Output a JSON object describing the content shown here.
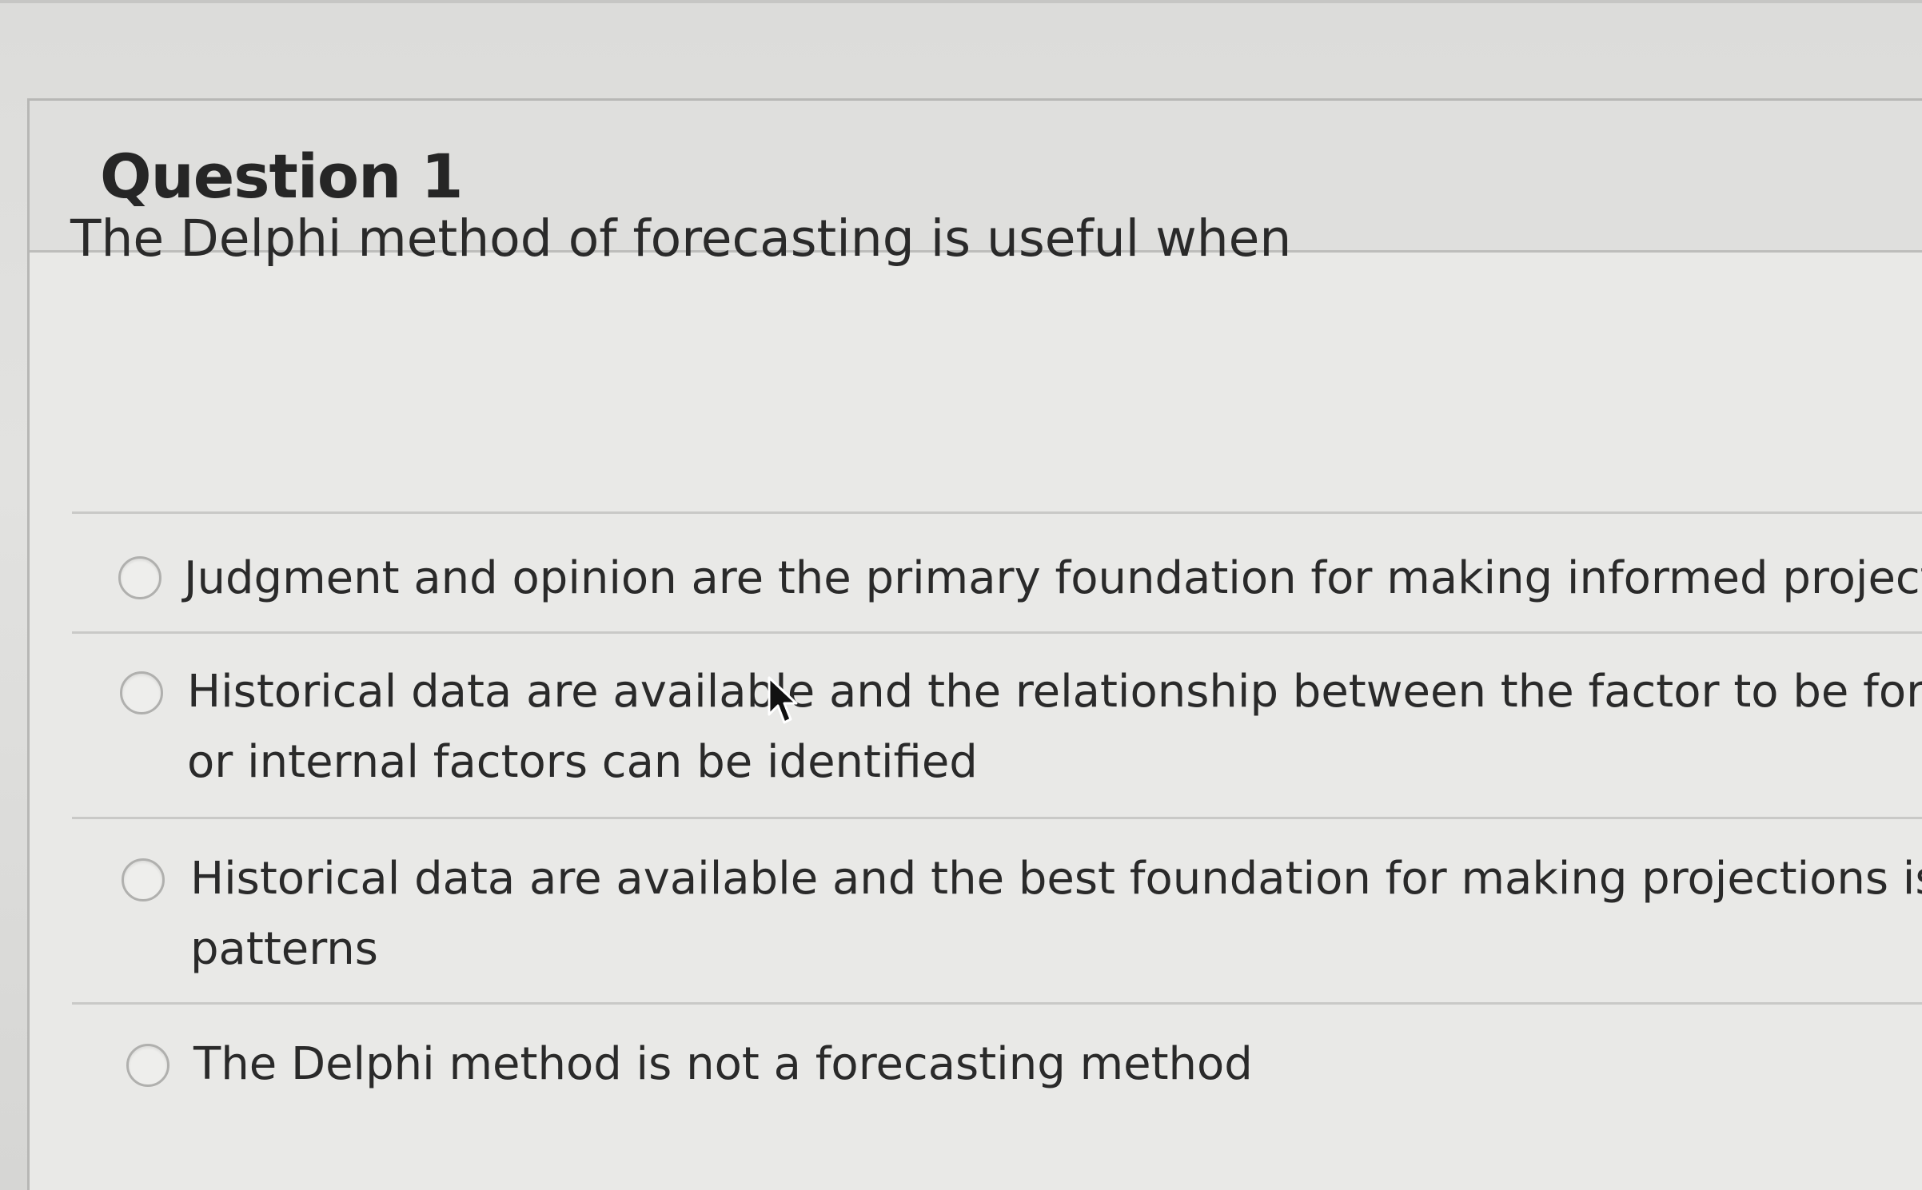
{
  "question": {
    "title": "Question 1",
    "prompt": "The Delphi method of forecasting is useful when"
  },
  "answers": [
    {
      "line1": "Judgment and opinion are the primary foundation for making informed projections",
      "line2": ""
    },
    {
      "line1": "Historical data are available and the relationship between the factor to be forecast ar",
      "line2": "or internal factors can be identified"
    },
    {
      "line1": "Historical data are available and the best foundation for making projections is to use",
      "line2": "patterns"
    },
    {
      "line1": "The Delphi method is not a forecasting method",
      "line2": ""
    }
  ],
  "colors": {
    "text": "#2a2a2a",
    "panel": "#e9e9e7",
    "border": "#b7b7b5"
  },
  "icons": {
    "cursor": "mouse-pointer-icon",
    "radio": "radio-button-icon"
  }
}
